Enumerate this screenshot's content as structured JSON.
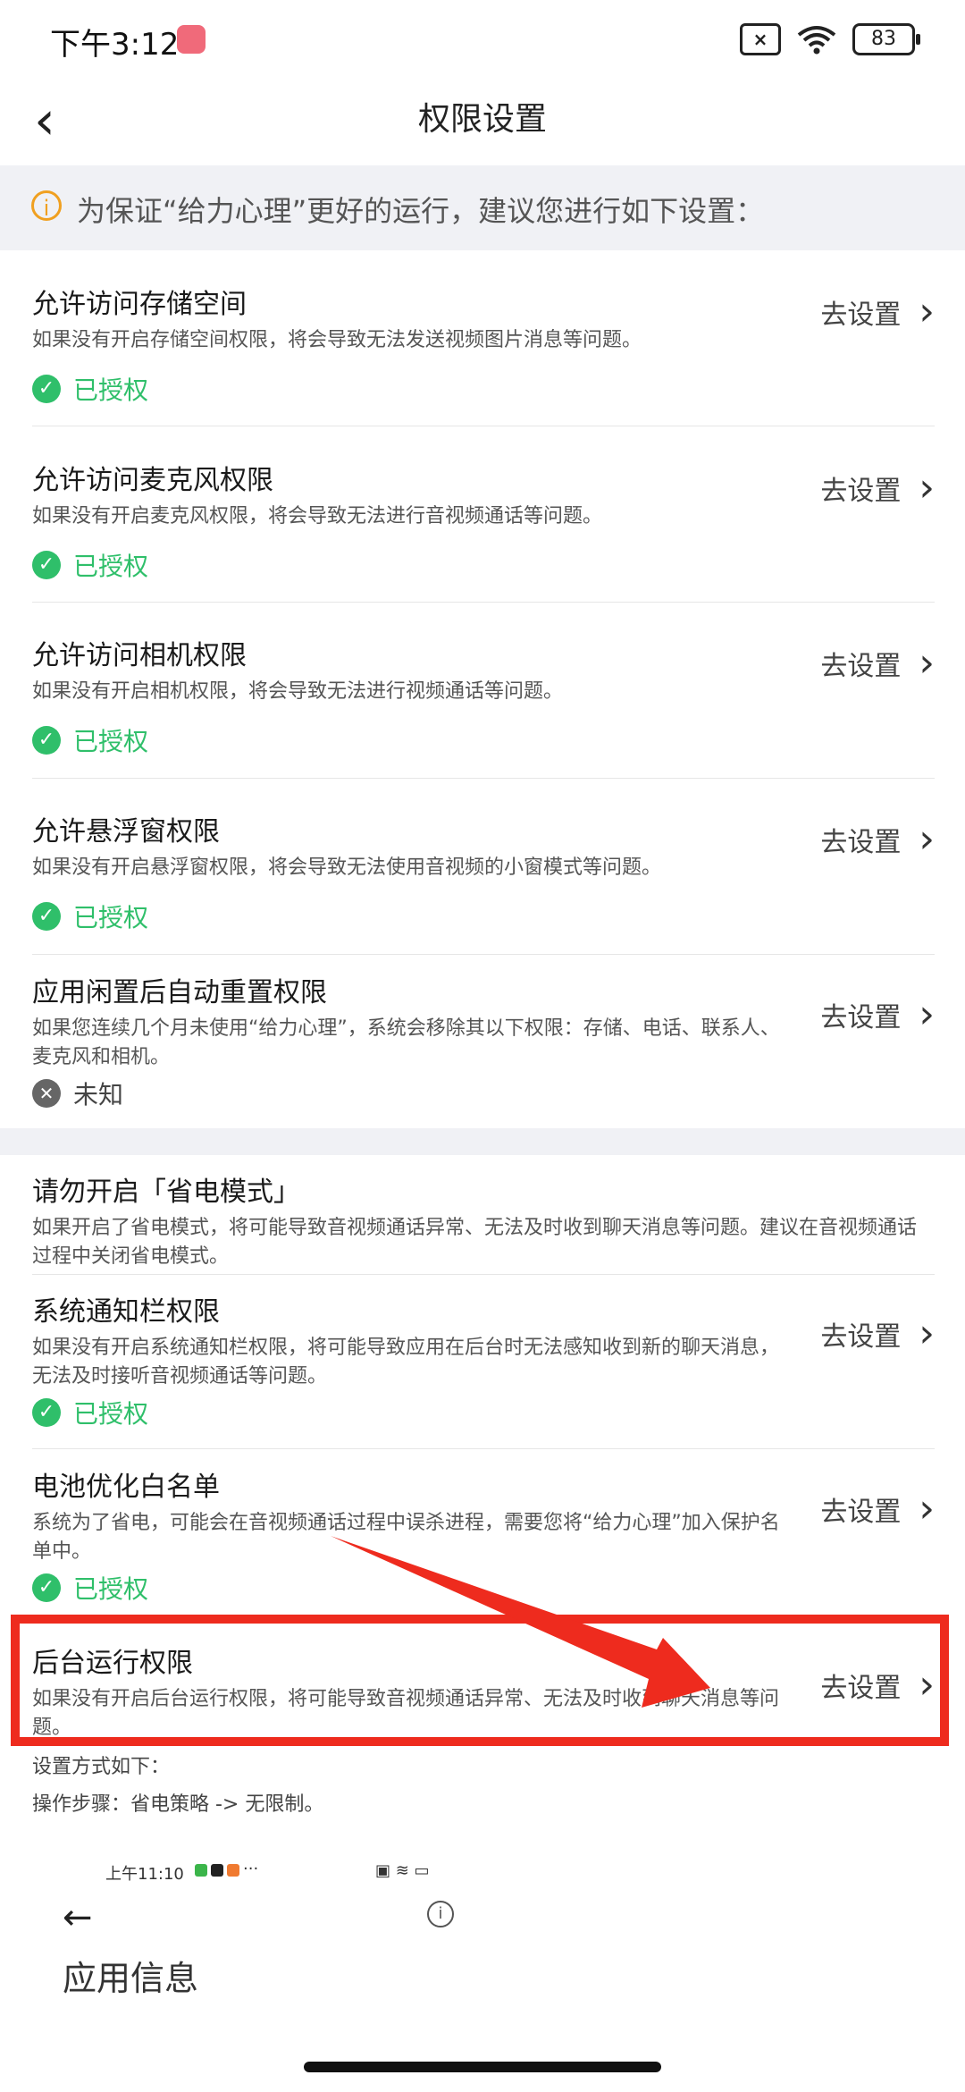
{
  "status_bar": {
    "time": "下午3:12",
    "battery": "83"
  },
  "nav": {
    "back_icon": "‹",
    "title": "权限设置"
  },
  "notice": {
    "icon": "i",
    "text": "为保证“给力心理”更好的运行，建议您进行如下设置："
  },
  "items": [
    {
      "title": "允许访问存储空间",
      "desc": "如果没有开启存储空间权限，将会导致无法发送视频图片消息等问题。",
      "action": "去设置",
      "status": "已授权"
    },
    {
      "title": "允许访问麦克风权限",
      "desc": "如果没有开启麦克风权限，将会导致无法进行音视频通话等问题。",
      "action": "去设置",
      "status": "已授权"
    },
    {
      "title": "允许访问相机权限",
      "desc": "如果没有开启相机权限，将会导致无法进行视频通话等问题。",
      "action": "去设置",
      "status": "已授权"
    },
    {
      "title": "允许悬浮窗权限",
      "desc": "如果没有开启悬浮窗权限，将会导致无法使用音视频的小窗模式等问题。",
      "action": "去设置",
      "status": "已授权"
    },
    {
      "title": "应用闲置后自动重置权限",
      "desc": "如果您连续几个月未使用“给力心理”，系统会移除其以下权限：存储、电话、联系人、麦克风和相机。",
      "action": "去设置",
      "status": "未知"
    },
    {
      "title": "请勿开启「省电模式」",
      "desc": "如果开启了省电模式，将可能导致音视频通话异常、无法及时收到聊天消息等问题。建议在音视频通话过程中关闭省电模式。"
    },
    {
      "title": "系统通知栏权限",
      "desc": "如果没有开启系统通知栏权限，将可能导致应用在后台时无法感知收到新的聊天消息，无法及时接听音视频通话等问题。",
      "action": "去设置",
      "status": "已授权"
    },
    {
      "title": "电池优化白名单",
      "desc": "系统为了省电，可能会在音视频通话过程中误杀进程，需要您将“给力心理”加入保护名单中。",
      "action": "去设置",
      "status": "已授权"
    },
    {
      "title": "后台运行权限",
      "desc": "如果没有开启后台运行权限，将可能导致音视频通话异常、无法及时收到聊天消息等问题。",
      "action": "去设置"
    }
  ],
  "setup": {
    "line1": "设置方式如下：",
    "line2": "操作步骤：省电策略 -> 无限制。"
  },
  "embedded_screenshot": {
    "status_time": "上午11:10",
    "status_more": "···",
    "back_icon": "←",
    "info_icon": "i",
    "title": "应用信息"
  }
}
